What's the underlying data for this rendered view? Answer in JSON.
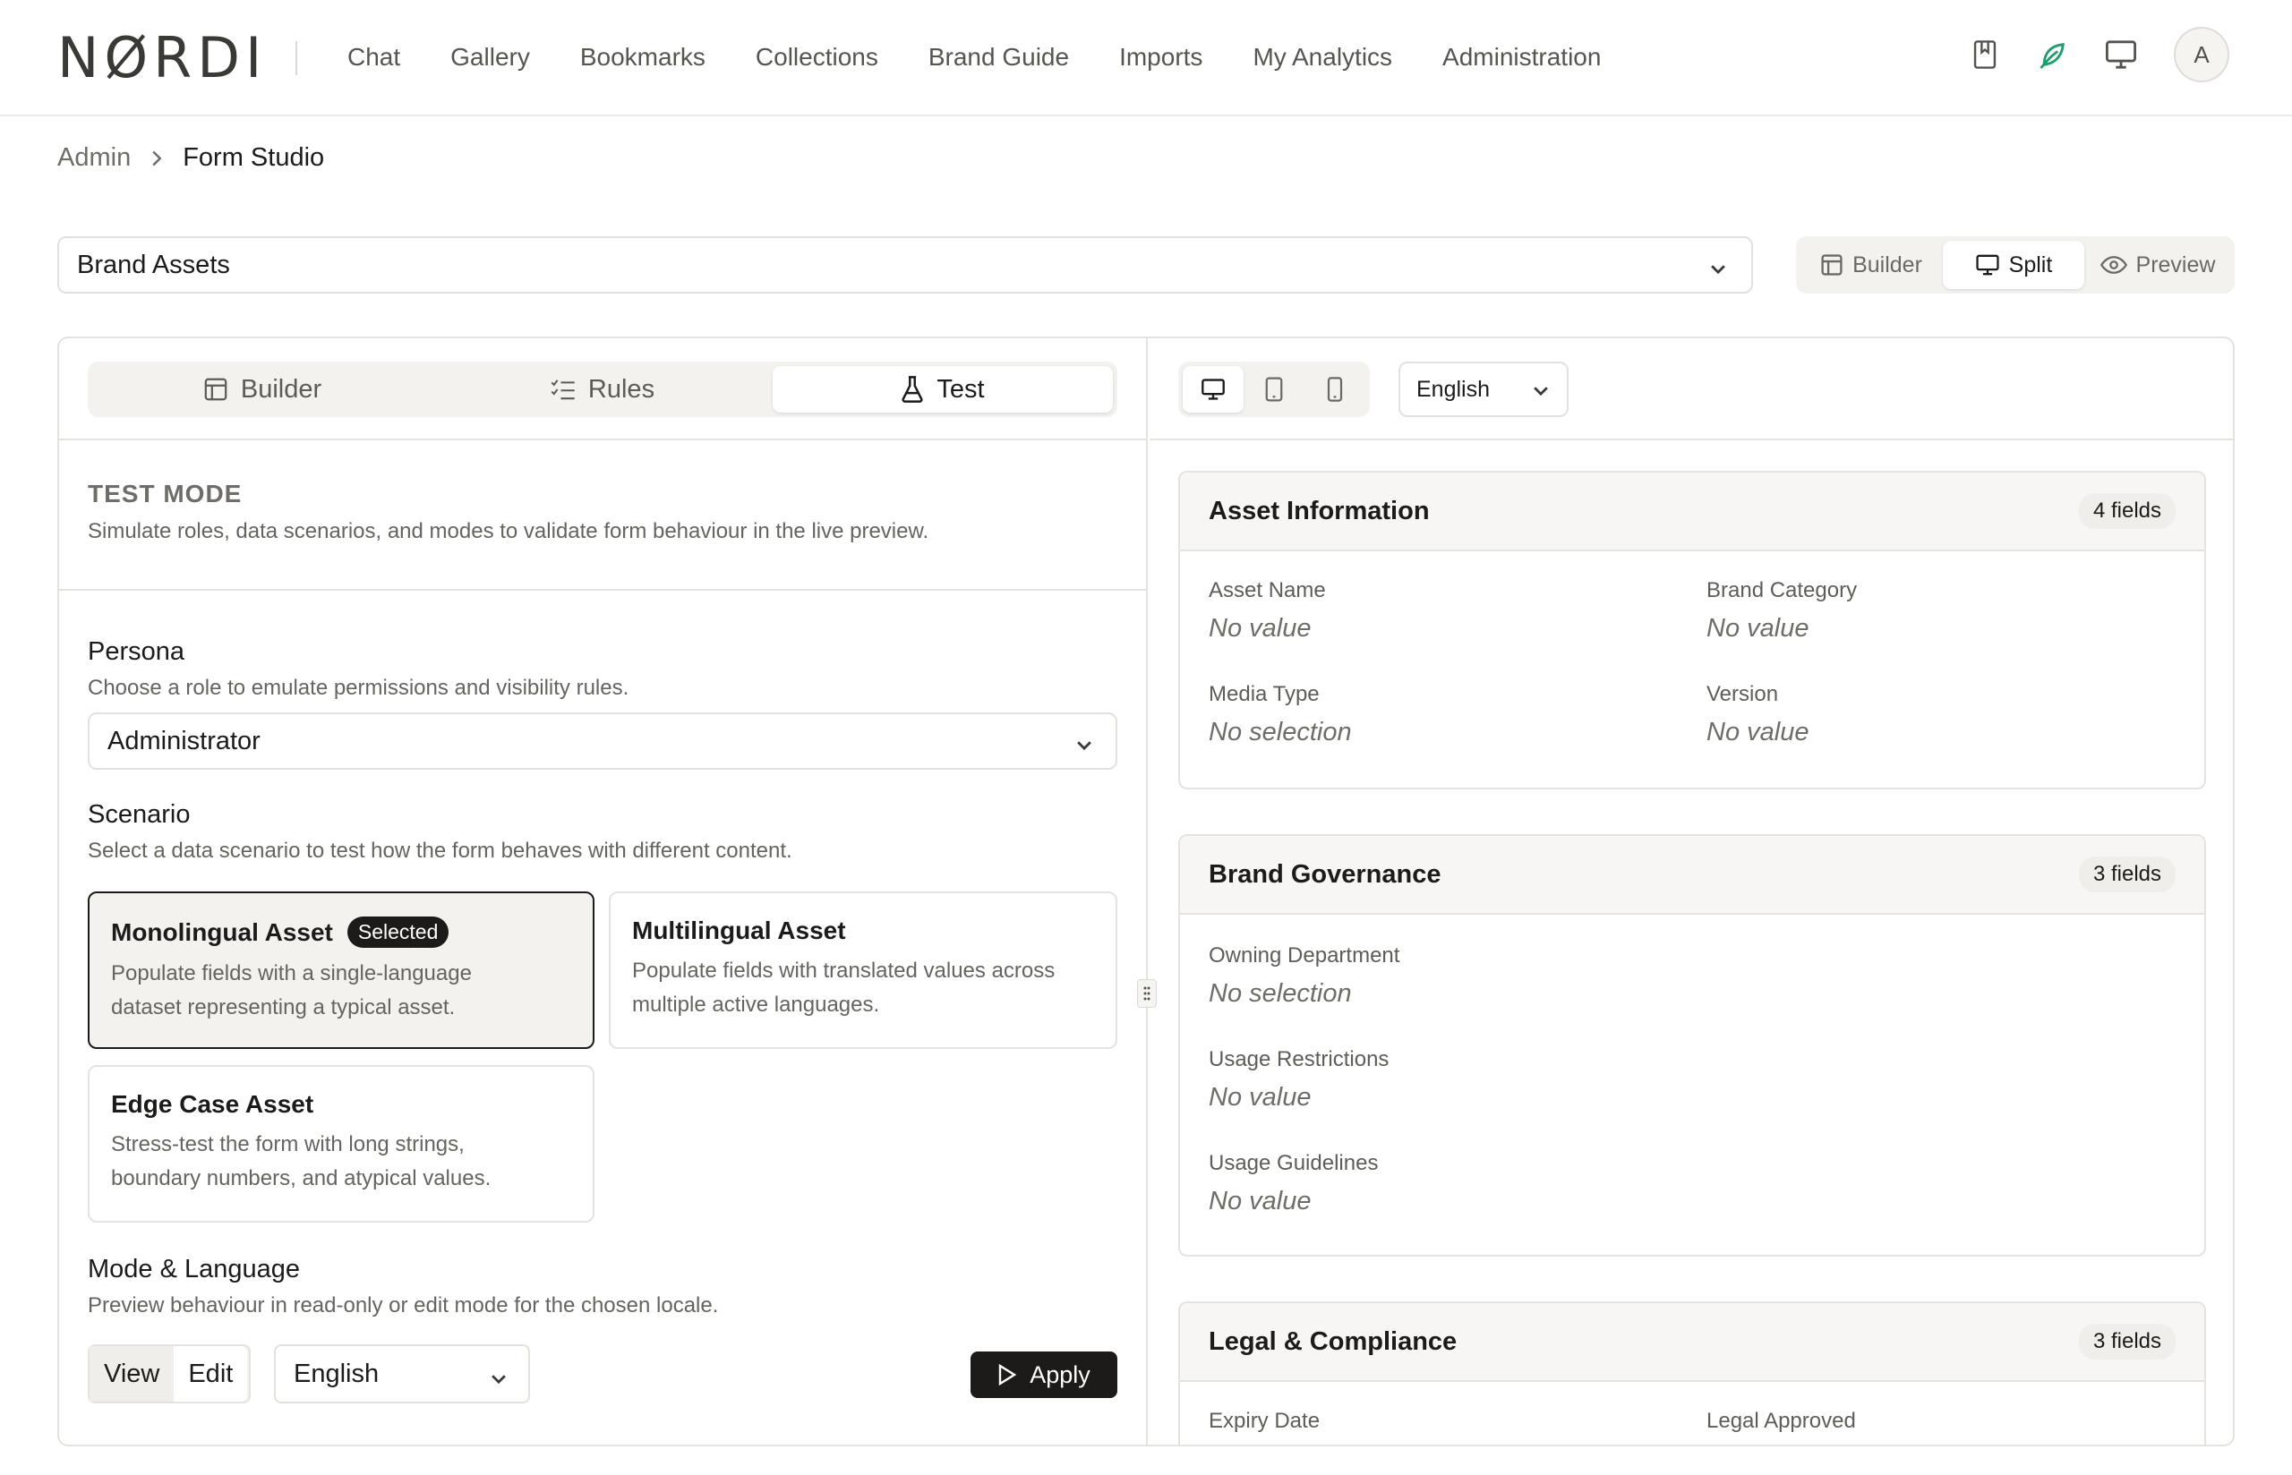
{
  "brand": {
    "logo_text": "NØRDI"
  },
  "nav": {
    "links": [
      "Chat",
      "Gallery",
      "Bookmarks",
      "Collections",
      "Brand Guide",
      "Imports",
      "My Analytics",
      "Administration"
    ],
    "avatar_initial": "A",
    "icons": [
      "bookmark-book-icon",
      "leaf-icon",
      "monitor-icon"
    ],
    "accent_color": "#1f9d6b"
  },
  "breadcrumb": {
    "parent": "Admin",
    "current": "Form Studio"
  },
  "form_selector": {
    "value": "Brand Assets"
  },
  "view_toggle": {
    "builder": "Builder",
    "split": "Split",
    "preview": "Preview",
    "active": "Split"
  },
  "left": {
    "tabs": {
      "builder": "Builder",
      "rules": "Rules",
      "test": "Test",
      "active": "Test"
    },
    "test_mode": {
      "title": "TEST MODE",
      "description": "Simulate roles, data scenarios, and modes to validate form behaviour in the live preview."
    },
    "persona": {
      "title": "Persona",
      "description": "Choose a role to emulate permissions and visibility rules.",
      "value": "Administrator"
    },
    "scenario": {
      "title": "Scenario",
      "description": "Select a data scenario to test how the form behaves with different content.",
      "cards": [
        {
          "title": "Monolingual Asset",
          "badge": "Selected",
          "desc_line1": "Populate fields with a single-language",
          "desc_line2": "dataset representing a typical asset."
        },
        {
          "title": "Multilingual Asset",
          "desc_line1": "Populate fields with translated values across",
          "desc_line2": "multiple active languages."
        },
        {
          "title": "Edge Case Asset",
          "desc_line1": "Stress-test the form with long strings,",
          "desc_line2": "boundary numbers, and atypical values."
        }
      ]
    },
    "mode_language": {
      "title": "Mode & Language",
      "description": "Preview behaviour in read-only or edit mode for the chosen locale.",
      "view": "View",
      "edit": "Edit",
      "language": "English",
      "apply": "Apply"
    }
  },
  "right": {
    "language": "English",
    "sections": [
      {
        "title": "Asset Information",
        "count": "4 fields",
        "fields": [
          {
            "label": "Asset Name",
            "value": "No value"
          },
          {
            "label": "Brand Category",
            "value": "No value"
          },
          {
            "label": "Media Type",
            "value": "No selection"
          },
          {
            "label": "Version",
            "value": "No value"
          }
        ]
      },
      {
        "title": "Brand Governance",
        "count": "3 fields",
        "fields": [
          {
            "label": "Owning Department",
            "value": "No selection"
          },
          {
            "label": "Usage Restrictions",
            "value": "No value"
          },
          {
            "label": "Usage Guidelines",
            "value": "No value"
          }
        ]
      },
      {
        "title": "Legal & Compliance",
        "count": "3 fields",
        "fields": [
          {
            "label": "Expiry Date"
          },
          {
            "label": "Legal Approved"
          }
        ]
      }
    ]
  }
}
